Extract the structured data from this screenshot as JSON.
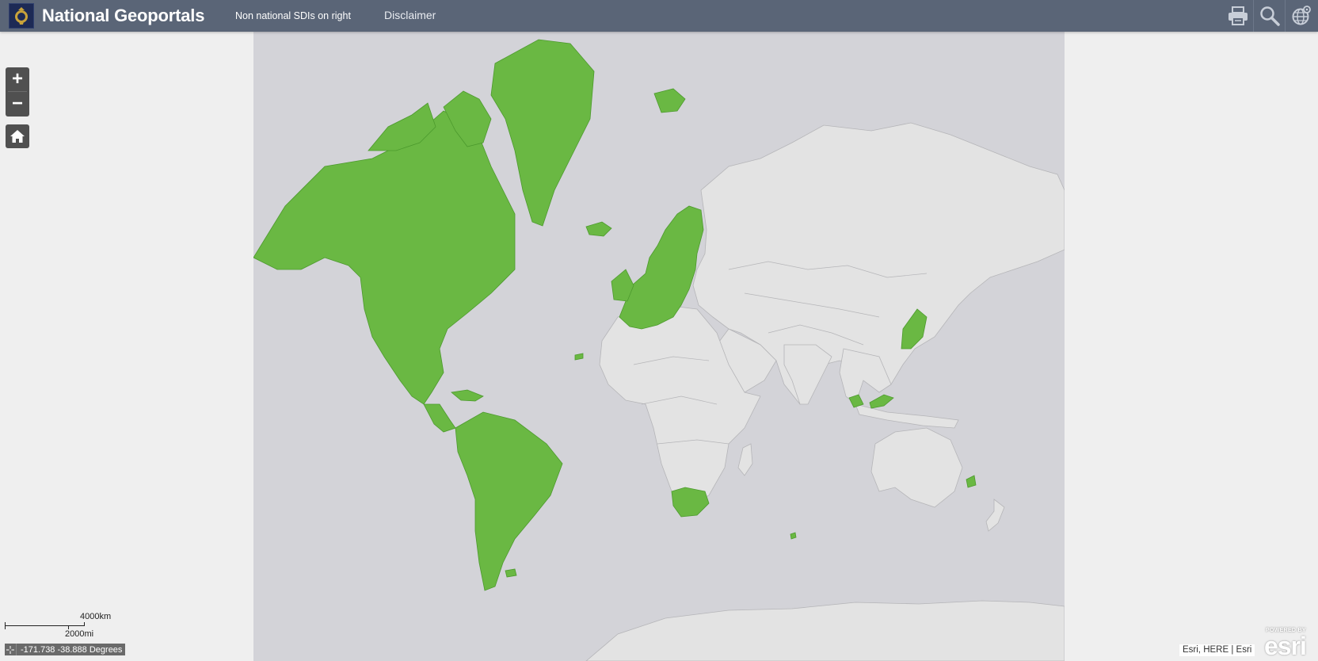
{
  "header": {
    "title": "National Geoportals",
    "nav": [
      {
        "label": "Non national SDIs on right"
      },
      {
        "label": "Disclaimer"
      }
    ],
    "tools": {
      "print_icon": "printer-icon",
      "search_icon": "search-icon",
      "basemap_icon": "globe-gear-icon"
    }
  },
  "map": {
    "zoom_in": "+",
    "zoom_out": "−",
    "home_icon": "home-icon",
    "scalebar": {
      "metric": "4000km",
      "imperial": "2000mi"
    },
    "coordinates": "-171.738 -38.888 Degrees",
    "attribution": "Esri, HERE | Esri",
    "powered_small": "POWERED BY",
    "powered_logo": "esri",
    "colors": {
      "ocean": "#d3d3d8",
      "land": "#e3e3e3",
      "highlight": "#6ab843",
      "header": "#5a6577"
    }
  }
}
